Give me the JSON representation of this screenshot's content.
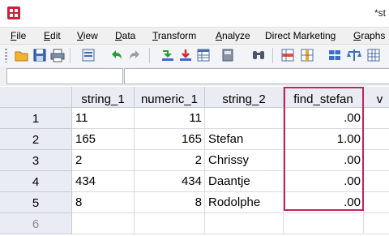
{
  "window": {
    "title": "*st"
  },
  "menu": [
    {
      "label": "File",
      "u": "F",
      "rest": "ile"
    },
    {
      "label": "Edit",
      "u": "E",
      "rest": "dit"
    },
    {
      "label": "View",
      "u": "V",
      "rest": "iew"
    },
    {
      "label": "Data",
      "u": "D",
      "rest": "ata"
    },
    {
      "label": "Transform",
      "u": "T",
      "rest": "ransform"
    },
    {
      "label": "Analyze",
      "u": "A",
      "rest": "nalyze"
    },
    {
      "label": "Direct Marketing",
      "u": "",
      "rest": "Direct Marketing"
    },
    {
      "label": "Graphs",
      "u": "G",
      "rest": "raphs"
    }
  ],
  "toolbar": {
    "icons": [
      "open-icon",
      "save-icon",
      "print-icon",
      "dialog-recall-icon",
      "undo-icon",
      "redo-icon",
      "go-to-case-icon",
      "go-to-variable-icon",
      "variables-icon",
      "run-descriptives-icon",
      "find-icon",
      "insert-cases-icon",
      "insert-variable-icon",
      "split-file-icon",
      "weight-cases-icon",
      "select-cases-icon"
    ]
  },
  "editor": {
    "cell_ref": "",
    "cell_value": ""
  },
  "grid": {
    "columns": [
      "string_1",
      "numeric_1",
      "string_2",
      "find_stefan",
      "v"
    ],
    "rows": [
      {
        "num": "1",
        "string_1": "11",
        "numeric_1": "11",
        "string_2": "",
        "find_stefan": ".00"
      },
      {
        "num": "2",
        "string_1": "165",
        "numeric_1": "165",
        "string_2": "Stefan",
        "find_stefan": "1.00"
      },
      {
        "num": "3",
        "string_1": "2",
        "numeric_1": "2",
        "string_2": "Chrissy",
        "find_stefan": ".00"
      },
      {
        "num": "4",
        "string_1": "434",
        "numeric_1": "434",
        "string_2": "Daantje",
        "find_stefan": ".00"
      },
      {
        "num": "5",
        "string_1": "8",
        "numeric_1": "8",
        "string_2": "Rodolphe",
        "find_stefan": ".00"
      },
      {
        "num": "6",
        "string_1": "",
        "numeric_1": "",
        "string_2": "",
        "find_stefan": ""
      }
    ],
    "highlight_color": "#c0245a"
  }
}
